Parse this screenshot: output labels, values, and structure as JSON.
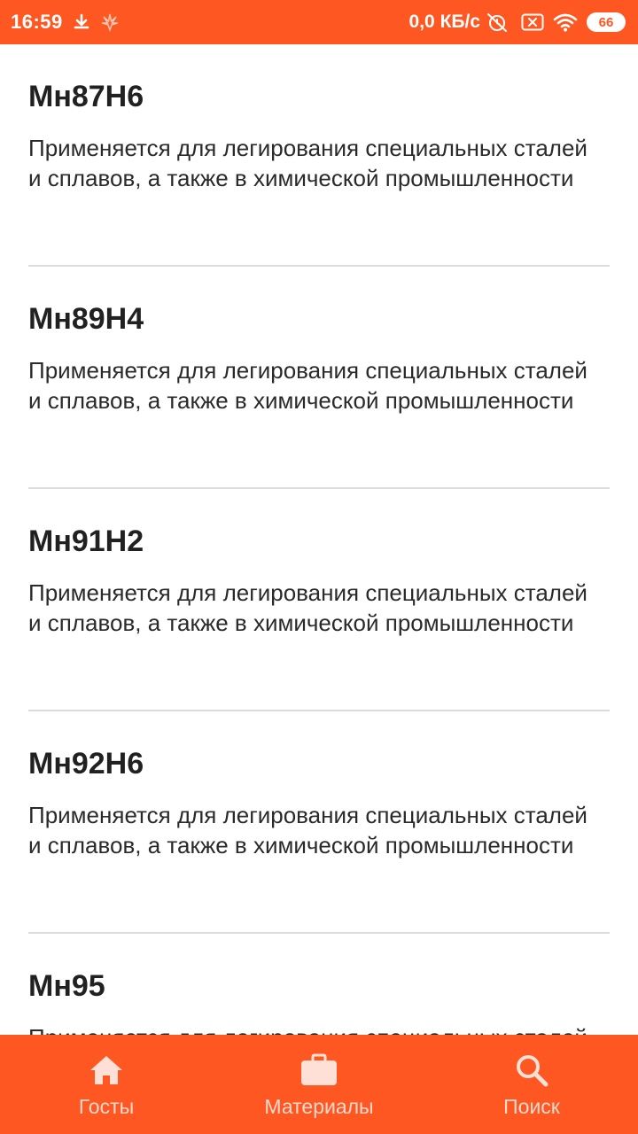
{
  "status_bar": {
    "time": "16:59",
    "net_speed": "0,0 КБ/с",
    "battery": "66"
  },
  "materials": [
    {
      "title": "Мн87Н6",
      "description": "Применяется для легирования специальных сталей и сплавов, а также в химической промышленности"
    },
    {
      "title": "Мн89Н4",
      "description": "Применяется для легирования специальных сталей и сплавов, а также в химической промышленности"
    },
    {
      "title": "Мн91Н2",
      "description": "Применяется для легирования специальных сталей и сплавов, а также в химической промышленности"
    },
    {
      "title": "Мн92Н6",
      "description": "Применяется для легирования специальных сталей и сплавов, а также в химической промышленности"
    },
    {
      "title": "Мн95",
      "description": "Применяется для легирования специальных сталей и сплавов, а также в химической промышленности"
    }
  ],
  "bottom_nav": {
    "items": [
      {
        "label": "Госты",
        "icon": "home-icon"
      },
      {
        "label": "Материалы",
        "icon": "briefcase-icon"
      },
      {
        "label": "Поиск",
        "icon": "search-icon"
      }
    ]
  },
  "colors": {
    "accent": "#ff5722",
    "divider": "#dcdcdc"
  }
}
